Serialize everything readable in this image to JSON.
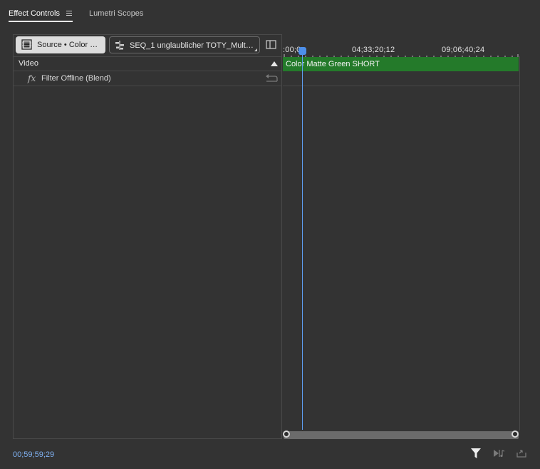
{
  "tabs": [
    {
      "label": "Effect Controls",
      "active": true
    },
    {
      "label": "Lumetri Scopes",
      "active": false
    }
  ],
  "toolbar": {
    "source_label": "Source • Color …",
    "sequence_label": "SEQ_1 unglaublicher TOTY_Mult…"
  },
  "effects": {
    "section_label": "Video",
    "fx_symbol": "fx",
    "items": [
      {
        "label": "Filter Offline (Blend)"
      }
    ]
  },
  "timeline": {
    "ruler_labels": [
      ":00;0",
      "04;33;20;12",
      "09;06;40;24"
    ],
    "clip_label": "Color Matte Green SHORT",
    "clip_color": "#247a2a",
    "playhead_color": "#4d8fea"
  },
  "footer": {
    "timecode": "00;59;59;29"
  },
  "icons": [
    "hamburger-menu-icon",
    "source-clip-icon",
    "sequence-icon",
    "panel-toggle-icon",
    "collapse-up-icon",
    "reset-icon",
    "filter-icon",
    "play-audio-icon",
    "export-icon"
  ]
}
